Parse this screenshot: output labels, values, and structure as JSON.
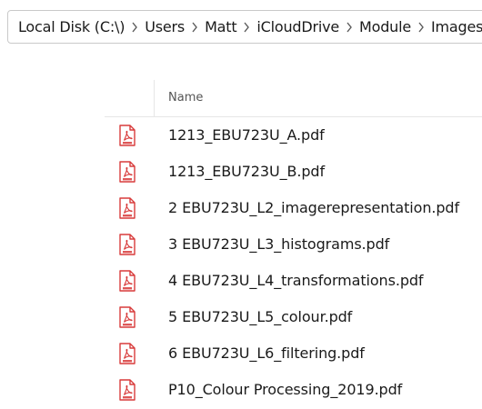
{
  "breadcrumb": {
    "items": [
      "Local Disk (C:\\)",
      "Users",
      "Matt",
      "iCloudDrive",
      "Module",
      "Images"
    ]
  },
  "list": {
    "column_name": "Name",
    "files": [
      {
        "name": "1213_EBU723U_A.pdf",
        "icon": "pdf-file-icon"
      },
      {
        "name": "1213_EBU723U_B.pdf",
        "icon": "pdf-file-icon"
      },
      {
        "name": "2 EBU723U_L2_imagerepresentation.pdf",
        "icon": "pdf-file-icon"
      },
      {
        "name": "3 EBU723U_L3_histograms.pdf",
        "icon": "pdf-file-icon"
      },
      {
        "name": "4 EBU723U_L4_transformations.pdf",
        "icon": "pdf-file-icon"
      },
      {
        "name": "5 EBU723U_L5_colour.pdf",
        "icon": "pdf-file-icon"
      },
      {
        "name": "6 EBU723U_L6_filtering.pdf",
        "icon": "pdf-file-icon"
      },
      {
        "name": "P10_Colour Processing_2019.pdf",
        "icon": "pdf-file-icon"
      }
    ]
  },
  "colors": {
    "pdf_icon_red": "#d83b3b",
    "border": "#c9c9c9",
    "divider": "#e6e6e6"
  }
}
